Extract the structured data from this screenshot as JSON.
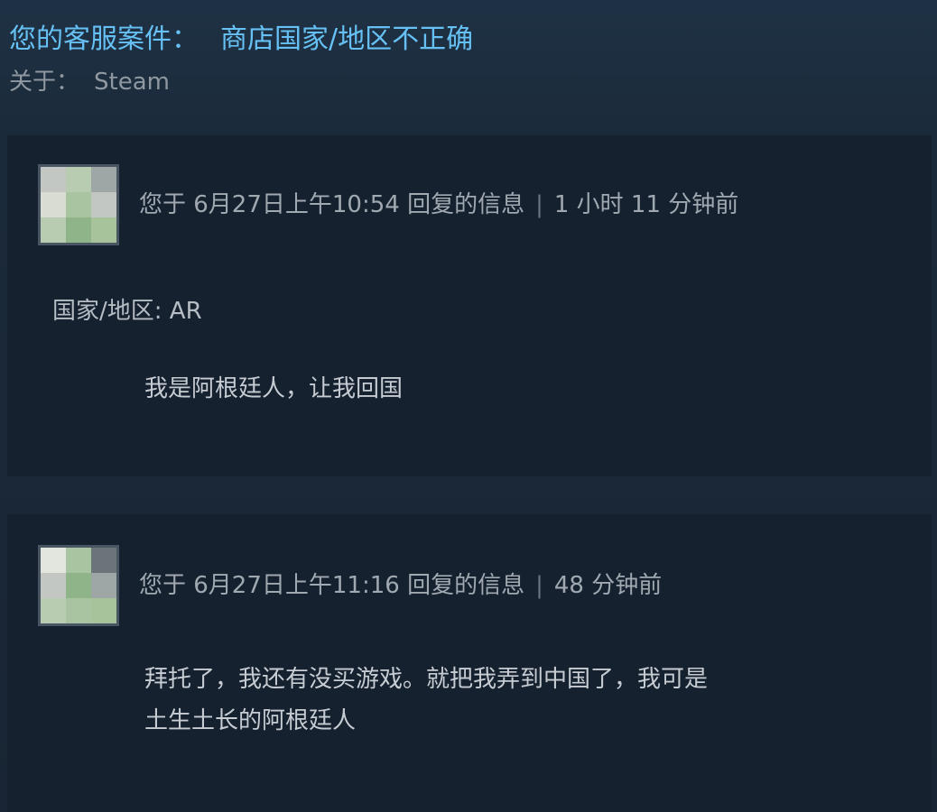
{
  "header": {
    "case_prefix": "您的客服案件：",
    "case_subject": "商店国家/地区不正确",
    "about_label": "关于：",
    "about_value": "Steam"
  },
  "messages": [
    {
      "meta": "您于 6月27日上午10:54 回复的信息",
      "relative_time": "1 小时 11 分钟前",
      "field": "国家/地区: AR",
      "lines": [
        "我是阿根廷人，让我回国"
      ]
    },
    {
      "meta": "您于 6月27日上午11:16 回复的信息",
      "relative_time": "48 分钟前",
      "lines": [
        "拜托了，我还有没买游戏。就把我弄到中国了，我可是",
        "土生土长的阿根廷人"
      ]
    }
  ],
  "separator": "|",
  "colors": {
    "accent": "#66c0f4",
    "background": "#1b2838",
    "card": "#162130",
    "muted_text": "#8f98a0"
  }
}
